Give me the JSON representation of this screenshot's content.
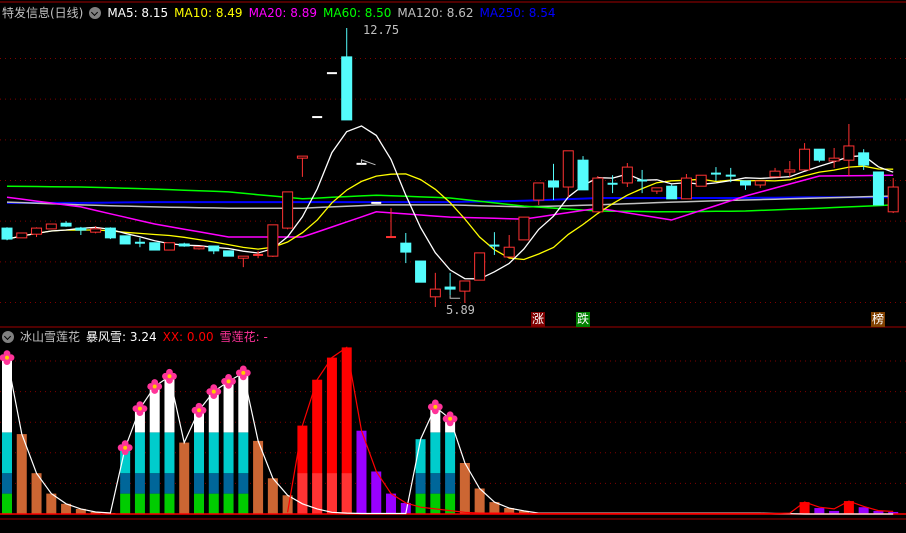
{
  "header": {
    "title": "特发信息(日线)",
    "ma": [
      {
        "label": "MA5: 8.15",
        "color": "#ffffff"
      },
      {
        "label": "MA10: 8.49",
        "color": "#ffff00"
      },
      {
        "label": "MA20: 8.89",
        "color": "#ff00ff"
      },
      {
        "label": "MA60: 8.50",
        "color": "#00ff00"
      },
      {
        "label": "MA120: 8.62",
        "color": "#c0c0c0"
      },
      {
        "label": "MA250: 8.54",
        "color": "#0000ff"
      }
    ]
  },
  "price_panel": {
    "high_label": "12.75",
    "low_label": "5.89",
    "high_index": 24,
    "low_index": 30,
    "grid_prices": [
      6,
      7,
      8,
      9,
      10,
      11,
      12
    ],
    "candles": [
      [
        7.83,
        7.56,
        7.85,
        7.53
      ],
      [
        7.59,
        7.71,
        7.71,
        7.59
      ],
      [
        7.68,
        7.83,
        7.85,
        7.61
      ],
      [
        7.81,
        7.93,
        7.93,
        7.81
      ],
      [
        7.95,
        7.88,
        8.0,
        7.86
      ],
      [
        7.83,
        7.78,
        7.86,
        7.66
      ],
      [
        7.73,
        7.81,
        7.88,
        7.7
      ],
      [
        7.83,
        7.59,
        7.85,
        7.56
      ],
      [
        7.64,
        7.44,
        7.64,
        7.44
      ],
      [
        7.47,
        7.46,
        7.59,
        7.36
      ],
      [
        7.47,
        7.29,
        7.47,
        7.29
      ],
      [
        7.29,
        7.47,
        7.47,
        7.29
      ],
      [
        7.44,
        7.39,
        7.47,
        7.37
      ],
      [
        7.32,
        7.37,
        7.37,
        7.3
      ],
      [
        7.39,
        7.27,
        7.39,
        7.19
      ],
      [
        7.27,
        7.14,
        7.27,
        7.14
      ],
      [
        7.09,
        7.14,
        7.14,
        6.87
      ],
      [
        7.16,
        7.17,
        7.27,
        7.09
      ],
      [
        7.14,
        7.91,
        7.91,
        7.12
      ],
      [
        7.83,
        8.72,
        8.72,
        7.8
      ],
      [
        9.55,
        9.6,
        9.6,
        9.09
      ],
      [
        10.56,
        10.56,
        10.56,
        10.56
      ],
      [
        11.64,
        11.64,
        11.64,
        11.64
      ],
      [
        12.04,
        10.49,
        12.75,
        10.49
      ],
      [
        9.41,
        9.41,
        9.41,
        9.41
      ],
      [
        8.45,
        8.45,
        8.45,
        8.45
      ],
      [
        7.6,
        7.61,
        8.32,
        7.59
      ],
      [
        7.46,
        7.24,
        7.71,
        6.97
      ],
      [
        7.02,
        6.5,
        7.02,
        6.5
      ],
      [
        6.14,
        6.33,
        6.73,
        5.89
      ],
      [
        6.38,
        6.33,
        6.73,
        6.18
      ],
      [
        6.28,
        6.53,
        6.53,
        5.99
      ],
      [
        6.55,
        7.22,
        7.22,
        6.55
      ],
      [
        7.4,
        7.37,
        7.73,
        7.17
      ],
      [
        7.12,
        7.36,
        7.66,
        7.12
      ],
      [
        7.54,
        8.1,
        8.1,
        7.54
      ],
      [
        8.52,
        8.94,
        8.94,
        8.4
      ],
      [
        8.99,
        8.84,
        9.41,
        8.52
      ],
      [
        8.84,
        9.73,
        9.73,
        8.59
      ],
      [
        9.5,
        8.77,
        9.6,
        8.77
      ],
      [
        8.23,
        9.06,
        9.11,
        8.23
      ],
      [
        8.92,
        8.9,
        9.13,
        8.69
      ],
      [
        8.94,
        9.33,
        9.43,
        8.84
      ],
      [
        9.0,
        8.98,
        9.26,
        8.69
      ],
      [
        8.74,
        8.82,
        8.82,
        8.67
      ],
      [
        8.86,
        8.55,
        8.9,
        8.55
      ],
      [
        8.55,
        9.06,
        9.16,
        8.55
      ],
      [
        8.86,
        9.13,
        9.13,
        8.86
      ],
      [
        9.17,
        9.15,
        9.33,
        8.99
      ],
      [
        9.12,
        9.1,
        9.31,
        8.96
      ],
      [
        8.99,
        8.89,
        8.99,
        8.77
      ],
      [
        8.89,
        8.99,
        8.99,
        8.82
      ],
      [
        9.09,
        9.23,
        9.31,
        9.09
      ],
      [
        9.21,
        9.26,
        9.48,
        9.09
      ],
      [
        9.26,
        9.77,
        9.92,
        9.26
      ],
      [
        9.77,
        9.5,
        9.77,
        9.45
      ],
      [
        9.48,
        9.55,
        9.8,
        9.31
      ],
      [
        9.5,
        9.85,
        10.39,
        9.11
      ],
      [
        9.68,
        9.38,
        9.77,
        9.26
      ],
      [
        9.21,
        8.4,
        9.21,
        8.4
      ],
      [
        8.23,
        8.84,
        9.06,
        8.2
      ]
    ],
    "ma_sampled": {
      "step": 5,
      "ma20": [
        8.59,
        8.35,
        7.93,
        7.61,
        7.61,
        8.23,
        8.1,
        8.05,
        8.32,
        8.03,
        8.62,
        9.11,
        9.13
      ],
      "ma60": [
        8.86,
        8.84,
        8.79,
        8.72,
        8.55,
        8.64,
        8.57,
        8.37,
        8.25,
        8.23,
        8.25,
        8.32,
        8.4
      ],
      "ma120": [
        8.47,
        8.4,
        8.35,
        8.32,
        8.32,
        8.4,
        8.4,
        8.35,
        8.4,
        8.47,
        8.52,
        8.57,
        8.62
      ],
      "ma250": [
        8.45,
        8.45,
        8.47,
        8.47,
        8.47,
        8.47,
        8.47,
        8.5,
        8.57,
        8.57,
        8.57,
        8.59,
        8.59
      ]
    },
    "signals": [
      {
        "index": 36,
        "label": "涨",
        "color": "#800000"
      },
      {
        "index": 39,
        "label": "跌",
        "color": "#008000"
      },
      {
        "index": 60,
        "label": "榜",
        "color": "#804000"
      }
    ]
  },
  "indicator_panel": {
    "name": "冰山雪莲花",
    "values": [
      {
        "label": "暴风雪: 3.24",
        "color": "#ffffff"
      },
      {
        "label": "XX: 0.00",
        "color": "#ff0000"
      },
      {
        "label": "雪莲花: -",
        "color": "#ff3399"
      }
    ],
    "grid_levels": [
      18,
      36,
      54,
      72,
      90
    ],
    "stack_levels": [
      12,
      24,
      48
    ],
    "stack_colors": [
      "#00cc00",
      "#006699",
      "#00cccc",
      "#ffffff"
    ],
    "bar_colors": {
      "brown": "#cc6633",
      "red": "#ff0000",
      "red_low": "#ff3333",
      "purple": "#9900ff"
    },
    "bars": [
      [
        "snow",
        92
      ],
      [
        "brown",
        47
      ],
      [
        "brown",
        24
      ],
      [
        "brown",
        12
      ],
      [
        "brown",
        6
      ],
      [
        "brown",
        3
      ],
      [
        "brown",
        1.2
      ],
      [
        "brown",
        0.6
      ],
      [
        "snow",
        39
      ],
      [
        "snow",
        62
      ],
      [
        "snow",
        75
      ],
      [
        "snow",
        81
      ],
      [
        "brown",
        42
      ],
      [
        "snow",
        61
      ],
      [
        "snow",
        72
      ],
      [
        "snow",
        78
      ],
      [
        "snow",
        83
      ],
      [
        "brown",
        43
      ],
      [
        "brown",
        21
      ],
      [
        "brown",
        11
      ],
      [
        "red",
        52
      ],
      [
        "red",
        79
      ],
      [
        "red",
        92
      ],
      [
        "red",
        98
      ],
      [
        "purple",
        49
      ],
      [
        "purple",
        25
      ],
      [
        "purple",
        12
      ],
      [
        "purple",
        6.5
      ],
      [
        "snow",
        44
      ],
      [
        "snow",
        63
      ],
      [
        "snow",
        56
      ],
      [
        "brown",
        30
      ],
      [
        "brown",
        15
      ],
      [
        "brown",
        7
      ],
      [
        "brown",
        3.5
      ],
      [
        "brown",
        1.8
      ],
      [
        "brown",
        0.5
      ],
      [
        "brown",
        0.5
      ],
      [
        "brown",
        0.5
      ],
      [
        "brown",
        0.5
      ],
      [
        "brown",
        0.5
      ],
      [
        "brown",
        0.5
      ],
      [
        "brown",
        0.5
      ],
      [
        "brown",
        0.5
      ],
      [
        "brown",
        0.5
      ],
      [
        "brown",
        0.5
      ],
      [
        "brown",
        0.5
      ],
      [
        "brown",
        0.5
      ],
      [
        "brown",
        0.5
      ],
      [
        "brown",
        0.5
      ],
      [
        "brown",
        0.5
      ],
      [
        "brown",
        0.5
      ],
      [
        "brown",
        0.5
      ],
      [
        "brown",
        0.3
      ],
      [
        "red",
        7
      ],
      [
        "purple",
        3.5
      ],
      [
        "purple",
        1.8
      ],
      [
        "red",
        7.6
      ],
      [
        "purple",
        4
      ],
      [
        "purple",
        1.8
      ],
      [
        "purple",
        1.2
      ]
    ],
    "flowers": [
      0,
      8,
      9,
      10,
      11,
      13,
      14,
      15,
      16,
      29,
      30
    ],
    "white_line": [
      92,
      47,
      24,
      12,
      6,
      3,
      1.2,
      0.6,
      39,
      62,
      75,
      81,
      42,
      61,
      72,
      78,
      83,
      43,
      21,
      11,
      6,
      3,
      1,
      0.5,
      0.3,
      0.3,
      0.3,
      0.3,
      44,
      63,
      56,
      30,
      15,
      7,
      3.5,
      1.8,
      0.5,
      0.5,
      0.5,
      0.5,
      0.5,
      0.5,
      0.5,
      0.5,
      0.5,
      0.5,
      0.5,
      0.5,
      0.5,
      0.5,
      0.5,
      0.5,
      0.3,
      0.2,
      0,
      0,
      0,
      0,
      0,
      0,
      0
    ],
    "red_line": [
      null,
      null,
      null,
      null,
      null,
      null,
      null,
      null,
      null,
      null,
      null,
      null,
      null,
      null,
      null,
      null,
      null,
      null,
      null,
      1,
      52,
      79,
      92,
      98,
      49,
      25,
      12,
      6.5,
      4,
      3,
      2,
      1,
      0.5,
      0.5,
      0.5,
      0.3,
      0.3,
      0.3,
      0.3,
      0.3,
      0.3,
      0.3,
      0.3,
      0.3,
      0.3,
      0.3,
      0.3,
      0.3,
      0.3,
      0.3,
      0.3,
      0.3,
      0.3,
      0.5,
      7,
      4,
      3,
      7.6,
      4.5,
      2,
      1.5
    ]
  }
}
